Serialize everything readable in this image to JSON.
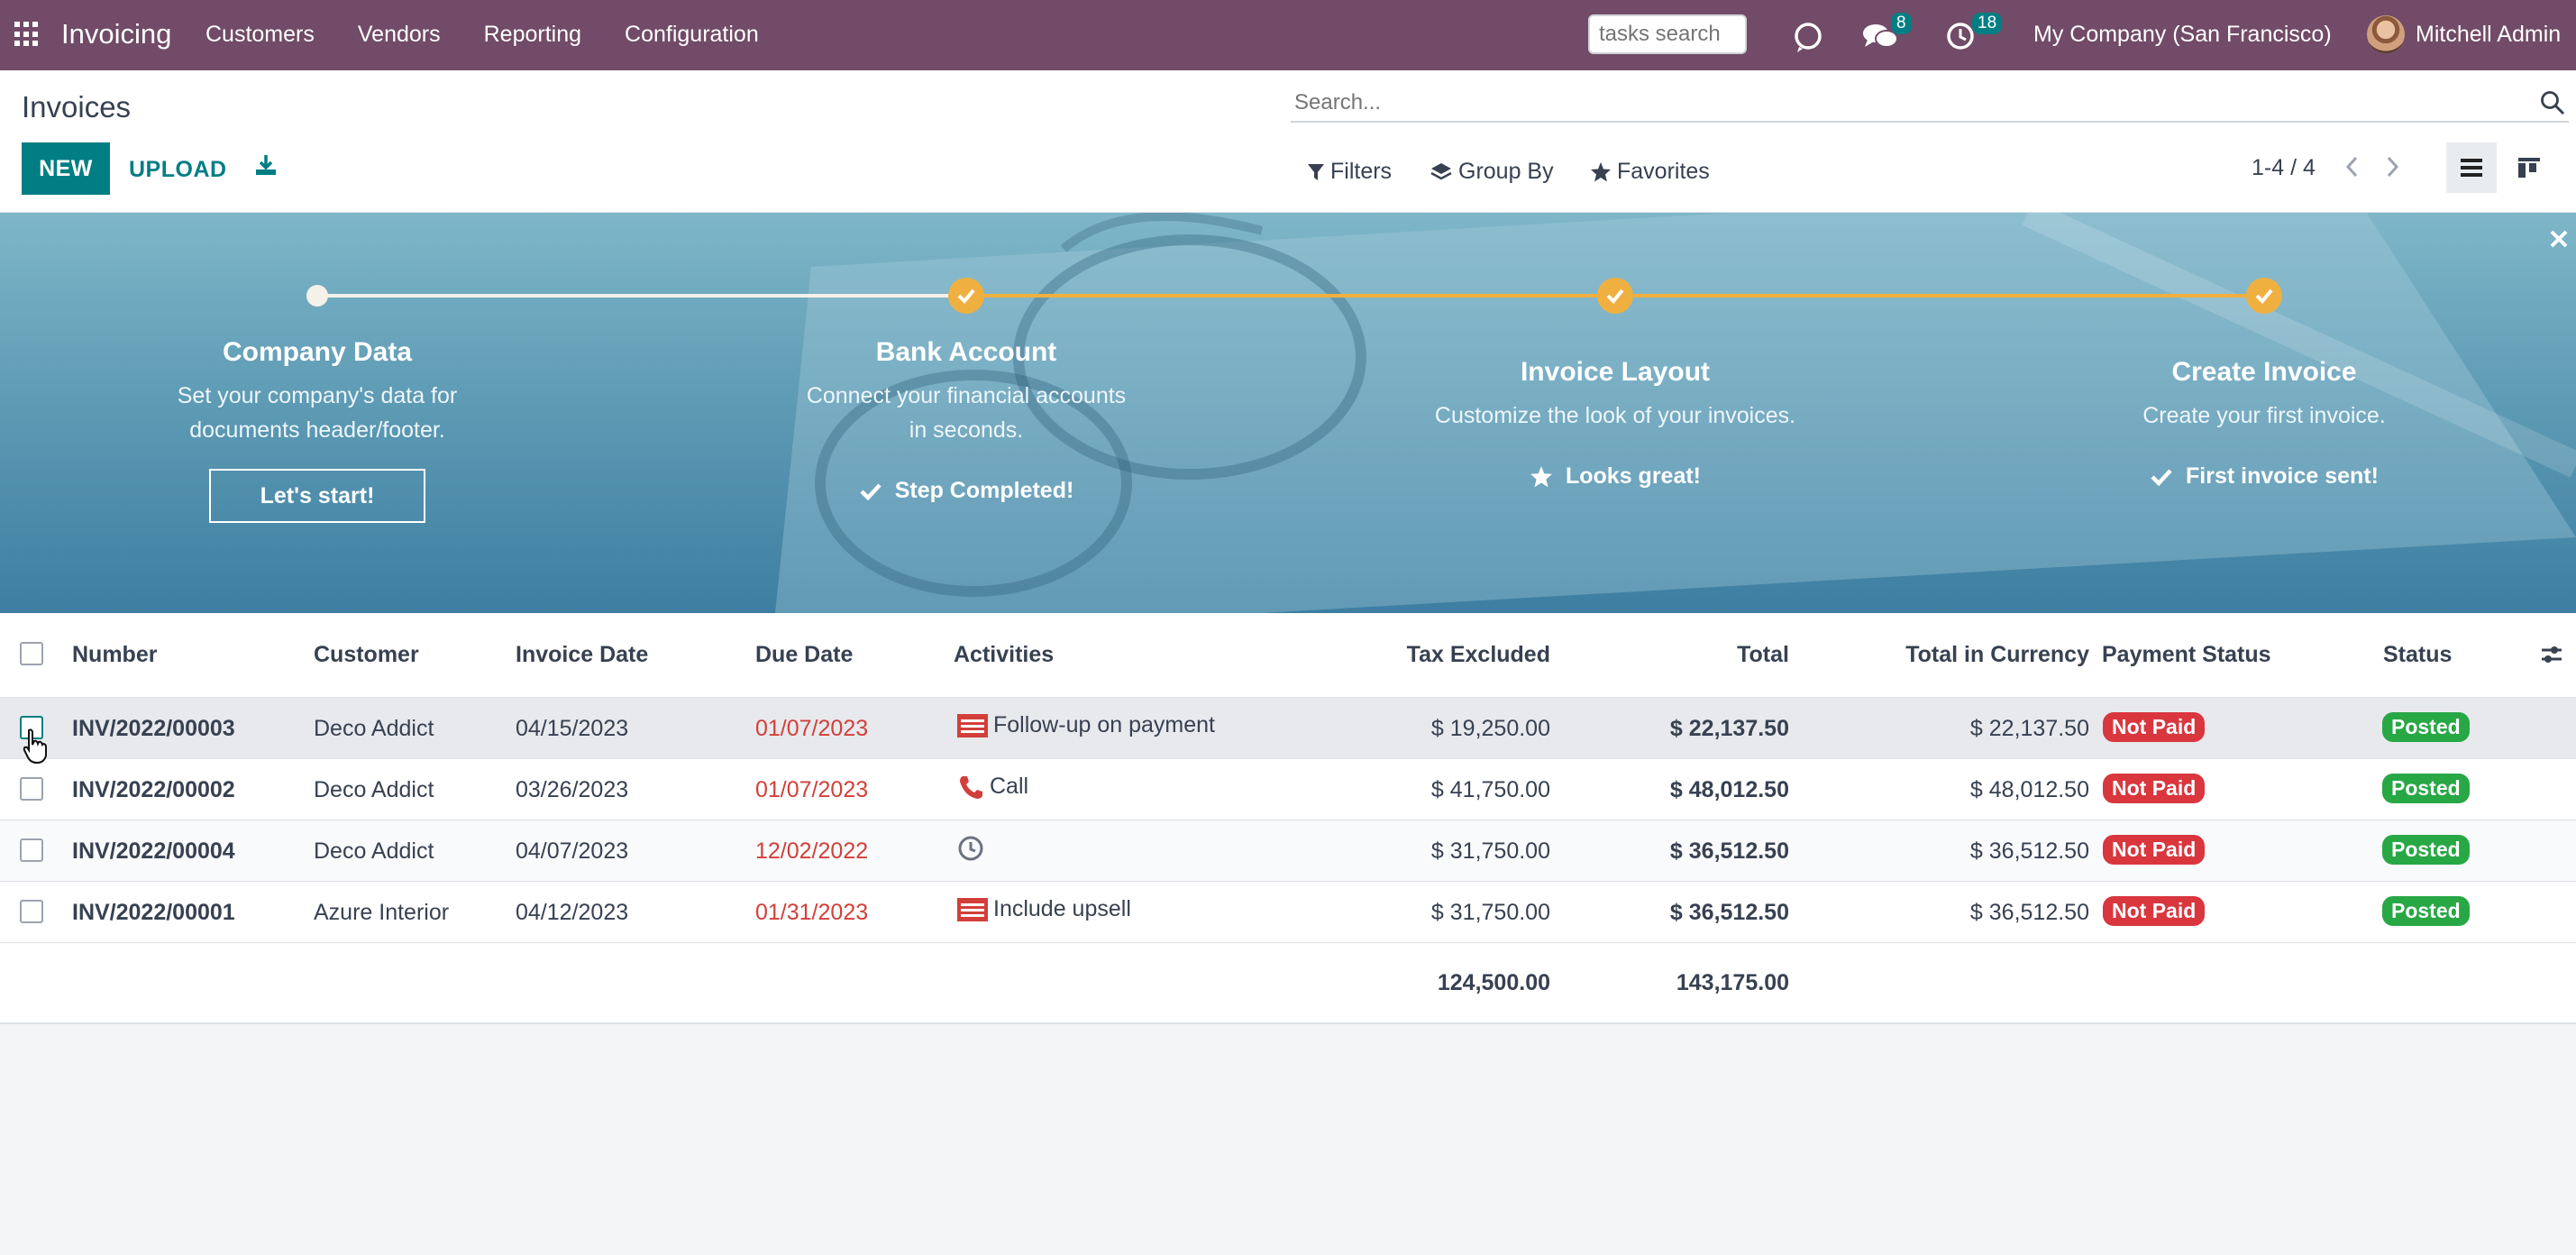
{
  "navbar": {
    "app_name": "Invoicing",
    "menu": [
      "Customers",
      "Vendors",
      "Reporting",
      "Configuration"
    ],
    "tasks_search_placeholder": "tasks search",
    "messages_count": "8",
    "activities_count": "18",
    "company": "My Company (San Francisco)",
    "user": "Mitchell Admin",
    "icons": {
      "apps": "apps-grid-icon",
      "discuss": "chat-bubble-icon",
      "messages": "chat-icon",
      "activities": "clock-icon"
    },
    "bg_color": "#714b67"
  },
  "control_panel": {
    "breadcrumb": "Invoices",
    "new_label": "NEW",
    "upload_label": "UPLOAD",
    "search_placeholder": "Search...",
    "filters_label": "Filters",
    "group_by_label": "Group By",
    "favorites_label": "Favorites",
    "pager": "1-4 / 4",
    "accent_color": "#017e84"
  },
  "banner": {
    "steps": [
      {
        "title": "Company Data",
        "description": "Set your company's data for documents header/footer.",
        "button_label": "Let's start!",
        "done": false
      },
      {
        "title": "Bank Account",
        "description": "Connect your financial accounts in seconds.",
        "done_label": "Step Completed!",
        "done": true,
        "done_icon": "check-icon"
      },
      {
        "title": "Invoice Layout",
        "description": "Customize the look of your invoices.",
        "done_label": "Looks great!",
        "done": true,
        "done_icon": "star-icon"
      },
      {
        "title": "Create Invoice",
        "description": "Create your first invoice.",
        "done_label": "First invoice sent!",
        "done": true,
        "done_icon": "check-icon"
      }
    ],
    "completed_color": "#f0b040"
  },
  "table": {
    "headers": {
      "number": "Number",
      "customer": "Customer",
      "invoice_date": "Invoice Date",
      "due_date": "Due Date",
      "activities": "Activities",
      "tax_excluded": "Tax Excluded",
      "total": "Total",
      "total_currency": "Total in Currency",
      "payment_status": "Payment Status",
      "status": "Status"
    },
    "rows": [
      {
        "number": "INV/2022/00003",
        "customer": "Deco Addict",
        "invoice_date": "04/15/2023",
        "due_date": "01/07/2023",
        "activity": "Follow-up on payment",
        "activity_icon": "list-icon",
        "tax_excluded": "$ 19,250.00",
        "total": "$ 22,137.50",
        "total_currency": "$ 22,137.50",
        "payment_status": "Not Paid",
        "status": "Posted"
      },
      {
        "number": "INV/2022/00002",
        "customer": "Deco Addict",
        "invoice_date": "03/26/2023",
        "due_date": "01/07/2023",
        "activity": "Call",
        "activity_icon": "phone-icon",
        "tax_excluded": "$ 41,750.00",
        "total": "$ 48,012.50",
        "total_currency": "$ 48,012.50",
        "payment_status": "Not Paid",
        "status": "Posted"
      },
      {
        "number": "INV/2022/00004",
        "customer": "Deco Addict",
        "invoice_date": "04/07/2023",
        "due_date": "12/02/2022",
        "activity": "",
        "activity_icon": "clock-icon",
        "tax_excluded": "$ 31,750.00",
        "total": "$ 36,512.50",
        "total_currency": "$ 36,512.50",
        "payment_status": "Not Paid",
        "status": "Posted"
      },
      {
        "number": "INV/2022/00001",
        "customer": "Azure Interior",
        "invoice_date": "04/12/2023",
        "due_date": "01/31/2023",
        "activity": "Include upsell",
        "activity_icon": "list-icon",
        "tax_excluded": "$ 31,750.00",
        "total": "$ 36,512.50",
        "total_currency": "$ 36,512.50",
        "payment_status": "Not Paid",
        "status": "Posted"
      }
    ],
    "totals": {
      "tax_excluded": "124,500.00",
      "total": "143,175.00"
    },
    "colors": {
      "overdue": "#d23f3a",
      "not_paid": "#d9363e",
      "posted": "#28a745"
    }
  }
}
